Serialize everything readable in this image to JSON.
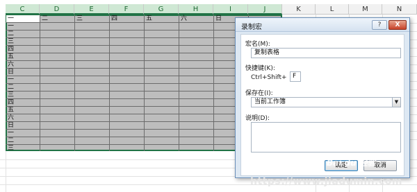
{
  "sheet": {
    "column_headers": [
      "C",
      "D",
      "E",
      "F",
      "G",
      "H",
      "I",
      "J",
      "K",
      "L",
      "M",
      "N"
    ],
    "header_row": [
      "一",
      "二",
      "三",
      "四",
      "五",
      "六",
      "日"
    ],
    "row_labels": [
      "一",
      "二",
      "三",
      "四",
      "五",
      "六",
      "日",
      "一",
      "二",
      "三",
      "四",
      "五",
      "六",
      "日",
      "一",
      "二",
      "三"
    ]
  },
  "dialog": {
    "title": "录制宏",
    "help_button": "?",
    "close_button": "X",
    "macro_name_label": "宏名(M):",
    "macro_name_value": "复制表格",
    "shortcut_label": "快捷键(K):",
    "shortcut_prefix": "Ctrl+Shift+",
    "shortcut_key": "F",
    "store_in_label": "保存在(I):",
    "store_in_value": "当前工作簿",
    "description_label": "说明(D):",
    "description_value": "",
    "ok_button": "确定",
    "cancel_button": "取消"
  },
  "watermark": {
    "text": "https://www.jiadumin.com",
    "logo": "Bai du 经验"
  }
}
